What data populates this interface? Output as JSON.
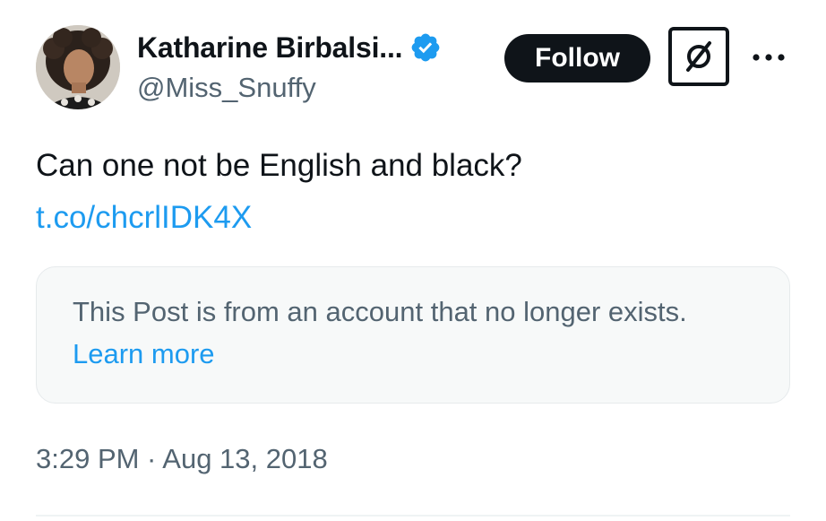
{
  "author": {
    "display_name": "Katharine Birbalsi...",
    "handle": "@Miss_Snuffy",
    "verified": true,
    "avatar_icon": "profile-photo"
  },
  "header": {
    "follow_label": "Follow",
    "grok_icon": "grok-icon",
    "more_icon": "more-dots-icon"
  },
  "tweet": {
    "text": "Can one not be English and black?",
    "link": "t.co/chcrlIDK4X"
  },
  "notice": {
    "text": "This Post is from an account that no longer exists.",
    "link_label": "Learn more"
  },
  "meta": {
    "timestamp": "3:29 PM · Aug 13, 2018"
  },
  "colors": {
    "text_primary": "#0f1419",
    "text_secondary": "#536471",
    "accent": "#1d9bf0",
    "card_bg": "#f7f9f9"
  }
}
